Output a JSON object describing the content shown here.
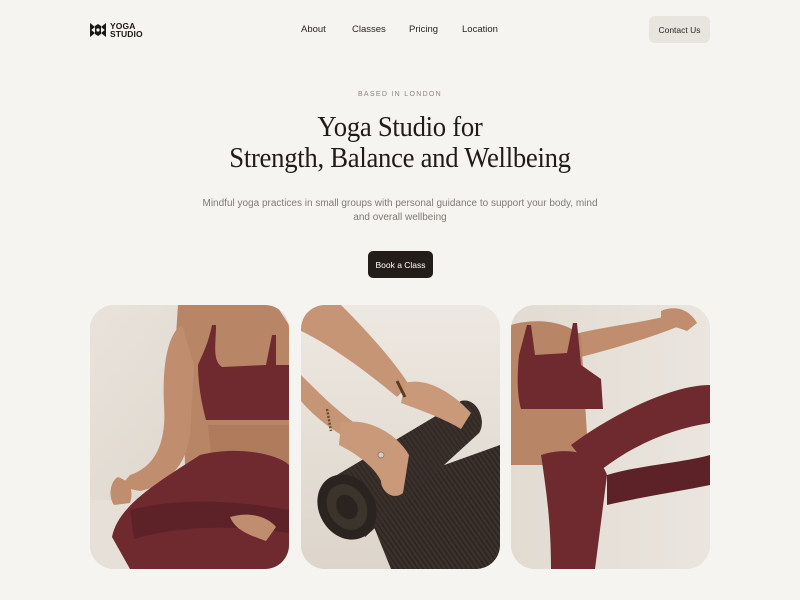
{
  "brand": {
    "line1": "YOGA",
    "line2": "STUDIO",
    "icon": "yoga-studio-logo-icon"
  },
  "nav": {
    "items": [
      {
        "label": "About"
      },
      {
        "label": "Classes"
      },
      {
        "label": "Pricing"
      },
      {
        "label": "Location"
      }
    ],
    "contact_label": "Contact Us"
  },
  "hero": {
    "eyebrow": "BASED IN LONDON",
    "title_line1": "Yoga Studio for",
    "title_line2": "Strength, Balance and Wellbeing",
    "subtitle": "Mindful yoga practices in small groups with personal guidance to support your body, mind and overall wellbeing",
    "cta_label": "Book a Class"
  },
  "gallery": [
    {
      "icon": "seated-yoga-pose-photo"
    },
    {
      "icon": "rolling-yoga-mat-photo"
    },
    {
      "icon": "standing-stretch-pose-photo"
    }
  ],
  "colors": {
    "background": "#f6f4f1",
    "primary_button": "#231d1a",
    "secondary_button": "#e8e4de",
    "text": "#1f1b18",
    "muted_text": "#807a75",
    "outfit": "#6e2a2f"
  }
}
